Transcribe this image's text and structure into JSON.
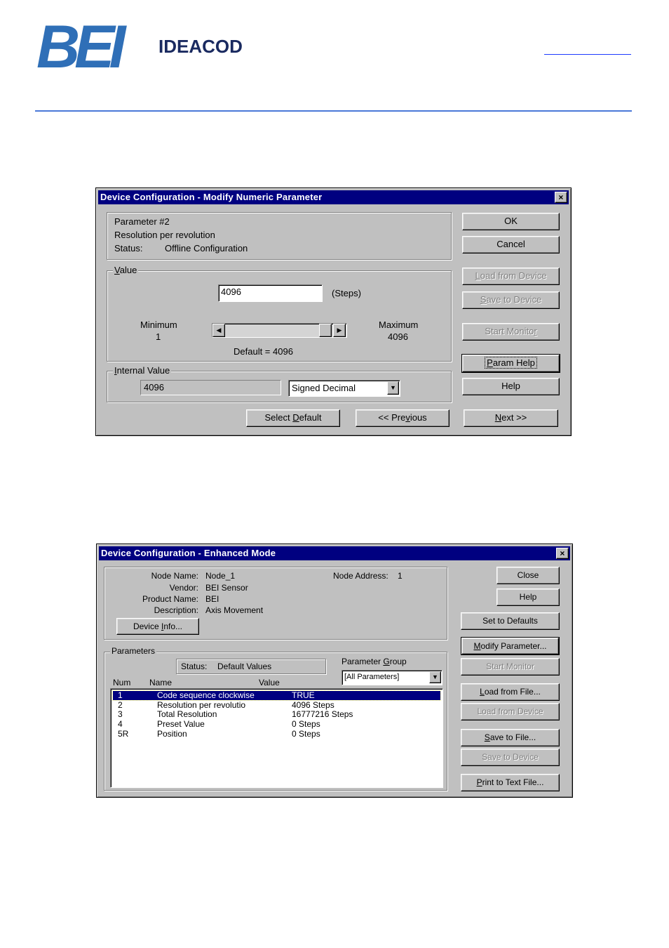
{
  "header": {
    "logo_primary": "BEI",
    "logo_secondary": "IDEACOD",
    "brand_color": "#2f6fb7"
  },
  "dialog1": {
    "title": "Device Configuration - Modify Numeric Parameter",
    "close_glyph": "×",
    "info": {
      "param_number": "Parameter #2",
      "param_name": "Resolution per revolution",
      "status_label": "Status:",
      "status_value": "Offline Configuration"
    },
    "value_group": {
      "label_u": "V",
      "label_rest": "alue",
      "input_value": "4096",
      "units": "(Steps)",
      "minimum_label": "Minimum",
      "minimum_value": "1",
      "maximum_label": "Maximum",
      "maximum_value": "4096",
      "default_text": "Default = 4096",
      "slider_fraction": 1.0
    },
    "internal_group": {
      "label_u": "I",
      "label_rest": "nternal Value",
      "value": "4096",
      "format_selected": "Signed Decimal"
    },
    "buttons": {
      "ok": "OK",
      "cancel": "Cancel",
      "load_u": "L",
      "load_rest": "oad from Device",
      "save_u": "S",
      "save_rest": "ave to Device",
      "start_monitor_pre": "Start Monito",
      "start_monitor_u": "r",
      "param_help_u": "P",
      "param_help_rest": "aram Help",
      "help": "Help",
      "select_default_pre": "Select ",
      "select_default_u": "D",
      "select_default_rest": "efault",
      "previous_pre": "<< Pre",
      "previous_u": "v",
      "previous_rest": "ious",
      "next_u": "N",
      "next_rest": "ext >>"
    }
  },
  "dialog2": {
    "title": "Device Configuration - Enhanced Mode",
    "close_glyph": "×",
    "node": {
      "node_name_label": "Node Name:",
      "node_name_value": "Node_1",
      "vendor_label": "Vendor:",
      "vendor_value": "BEI Sensor",
      "product_label": "Product Name:",
      "product_value": "BEI",
      "description_label": "Description:",
      "description_value": "Axis Movement",
      "address_label": "Node Address:",
      "address_value": "1",
      "device_info_pre": "Device ",
      "device_info_u": "I",
      "device_info_rest": "nfo..."
    },
    "parameters": {
      "group_label": "Parameters",
      "status_label": "Status:",
      "status_value": "Default Values",
      "param_group_label_pre": "Parameter ",
      "param_group_label_u": "G",
      "param_group_label_rest": "roup",
      "param_group_selected": "[All Parameters]",
      "col_num": "Num",
      "col_name": "Name",
      "col_value": "Value",
      "rows": [
        {
          "num": "1",
          "name": "Code sequence clockwise",
          "value": "TRUE"
        },
        {
          "num": "2",
          "name": "Resolution per revolutio",
          "value": "4096 Steps"
        },
        {
          "num": "3",
          "name": "Total Resolution",
          "value": "16777216 Steps"
        },
        {
          "num": "4",
          "name": "Preset Value",
          "value": "0 Steps"
        },
        {
          "num": "5R",
          "name": "Position",
          "value": "0 Steps"
        }
      ]
    },
    "buttons": {
      "close": "Close",
      "help": "Help",
      "set_defaults": "Set to Defaults",
      "modify_u": "M",
      "modify_rest": "odify Parameter...",
      "start_monitor": "Start Monitor",
      "load_file_u": "L",
      "load_file_rest": "oad from File...",
      "load_device": "Load from Device",
      "save_file_u": "S",
      "save_file_rest": "ave to File...",
      "save_device": "Save to Device",
      "print_u": "P",
      "print_rest": "rint to Text File..."
    }
  }
}
